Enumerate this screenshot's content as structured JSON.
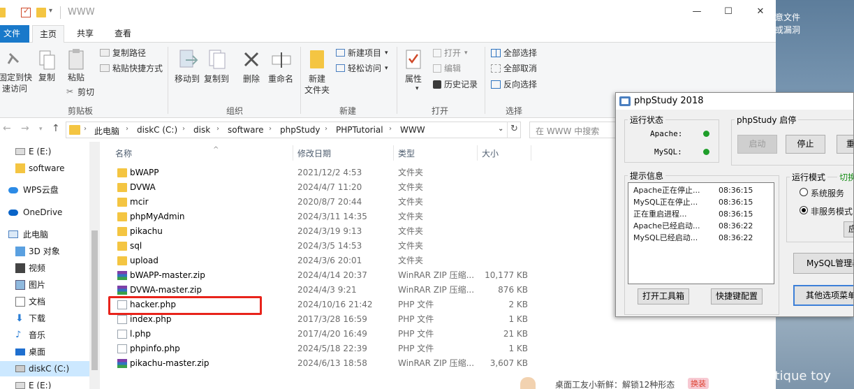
{
  "explorer": {
    "title": "WWW",
    "tabs": [
      "文件",
      "主页",
      "共享",
      "查看"
    ],
    "ribbon": {
      "clipboard": {
        "label": "剪贴板",
        "pin": "固定到快\n速访问",
        "copy": "复制",
        "paste": "粘贴",
        "copy_path": "复制路径",
        "paste_shortcut": "粘贴快捷方式",
        "cut": "剪切"
      },
      "organize": {
        "label": "组织",
        "move_to": "移动到",
        "copy_to": "复制到",
        "delete": "删除",
        "rename": "重命名"
      },
      "new": {
        "label": "新建",
        "new_folder": "新建\n文件夹",
        "new_item": "新建项目",
        "easy_access": "轻松访问"
      },
      "open": {
        "label": "打开",
        "properties": "属性",
        "open": "打开",
        "edit": "编辑",
        "history": "历史记录"
      },
      "select": {
        "label": "选择",
        "select_all": "全部选择",
        "select_none": "全部取消",
        "invert": "反向选择"
      }
    },
    "breadcrumb": [
      "此电脑",
      "diskC (C:)",
      "disk",
      "software",
      "phpStudy",
      "PHPTutorial",
      "WWW"
    ],
    "search_placeholder": "在 WWW 中搜索",
    "nav": [
      {
        "label": "E (E:)",
        "icon": "drive-icon"
      },
      {
        "label": "software",
        "icon": "folder-icon"
      },
      {
        "label": "WPS云盘",
        "icon": "cloud-icon"
      },
      {
        "label": "OneDrive",
        "icon": "onedrive-icon"
      },
      {
        "label": "此电脑",
        "icon": "computer-icon"
      },
      {
        "label": "3D 对象",
        "icon": "cube-icon"
      },
      {
        "label": "视频",
        "icon": "video-icon"
      },
      {
        "label": "图片",
        "icon": "picture-icon"
      },
      {
        "label": "文档",
        "icon": "document-icon"
      },
      {
        "label": "下载",
        "icon": "download-icon"
      },
      {
        "label": "音乐",
        "icon": "music-icon"
      },
      {
        "label": "桌面",
        "icon": "desktop-icon"
      },
      {
        "label": "diskC (C:)",
        "icon": "drive-icon"
      },
      {
        "label": "E (E:)",
        "icon": "drive-icon"
      }
    ],
    "columns": {
      "name": "名称",
      "date": "修改日期",
      "type": "类型",
      "size": "大小"
    },
    "files": [
      {
        "name": "bWAPP",
        "date": "2021/12/2 4:53",
        "type": "文件夹",
        "size": "",
        "kind": "folder"
      },
      {
        "name": "DVWA",
        "date": "2024/4/7 11:20",
        "type": "文件夹",
        "size": "",
        "kind": "folder"
      },
      {
        "name": "mcir",
        "date": "2020/8/7 20:44",
        "type": "文件夹",
        "size": "",
        "kind": "folder"
      },
      {
        "name": "phpMyAdmin",
        "date": "2024/3/11 14:35",
        "type": "文件夹",
        "size": "",
        "kind": "folder"
      },
      {
        "name": "pikachu",
        "date": "2024/3/19 9:13",
        "type": "文件夹",
        "size": "",
        "kind": "folder"
      },
      {
        "name": "sql",
        "date": "2024/3/5 14:53",
        "type": "文件夹",
        "size": "",
        "kind": "folder"
      },
      {
        "name": "upload",
        "date": "2024/3/6 20:01",
        "type": "文件夹",
        "size": "",
        "kind": "folder"
      },
      {
        "name": "bWAPP-master.zip",
        "date": "2024/4/14 20:37",
        "type": "WinRAR ZIP 压缩...",
        "size": "10,177 KB",
        "kind": "zip"
      },
      {
        "name": "DVWA-master.zip",
        "date": "2024/4/3 9:21",
        "type": "WinRAR ZIP 压缩...",
        "size": "876 KB",
        "kind": "zip"
      },
      {
        "name": "hacker.php",
        "date": "2024/10/16 21:42",
        "type": "PHP 文件",
        "size": "2 KB",
        "kind": "php"
      },
      {
        "name": "index.php",
        "date": "2017/3/28 16:59",
        "type": "PHP 文件",
        "size": "1 KB",
        "kind": "php"
      },
      {
        "name": "l.php",
        "date": "2017/4/20 16:49",
        "type": "PHP 文件",
        "size": "21 KB",
        "kind": "php"
      },
      {
        "name": "phpinfo.php",
        "date": "2024/5/18 22:39",
        "type": "PHP 文件",
        "size": "1 KB",
        "kind": "php"
      },
      {
        "name": "pikachu-master.zip",
        "date": "2024/6/13 18:58",
        "type": "WinRAR ZIP 压缩...",
        "size": "3,607 KB",
        "kind": "zip"
      }
    ]
  },
  "phpstudy": {
    "title": "phpStudy 2018",
    "run_status_label": "运行状态",
    "apache_label": "Apache:",
    "mysql_label": "MySQL:",
    "start_stop_label": "phpStudy 启停",
    "start_btn": "启动",
    "stop_btn": "停止",
    "restart_btn": "重",
    "info_label": "提示信息",
    "log": [
      {
        "msg": "Apache正在停止...",
        "time": "08:36:15"
      },
      {
        "msg": "MySQL正在停止...",
        "time": "08:36:15"
      },
      {
        "msg": "正在重启进程...",
        "time": "08:36:15"
      },
      {
        "msg": "Apache已经启动...",
        "time": "08:36:22"
      },
      {
        "msg": "MySQL已经启动...",
        "time": "08:36:22"
      }
    ],
    "run_mode_label": "运行模式",
    "switch_label": "切换",
    "mode_system": "系统服务",
    "mode_nonservice": "非服务模式",
    "apply_btn": "应",
    "open_toolbox_btn": "打开工具箱",
    "shortcut_config_btn": "快捷键配置",
    "mysql_manager_btn": "MySQL管理器",
    "other_menu_btn": "其他选项菜单"
  },
  "desktop": {
    "text1": "意文件",
    "text2": "或漏洞",
    "watermark": "CSDN @antique toy",
    "notification": "桌面工友小新鲜：解锁12种形态",
    "notification_btn": "换装"
  },
  "colors": {
    "accent": "#1979ca",
    "highlight": "#e8231b",
    "running": "#1f9e2a"
  }
}
